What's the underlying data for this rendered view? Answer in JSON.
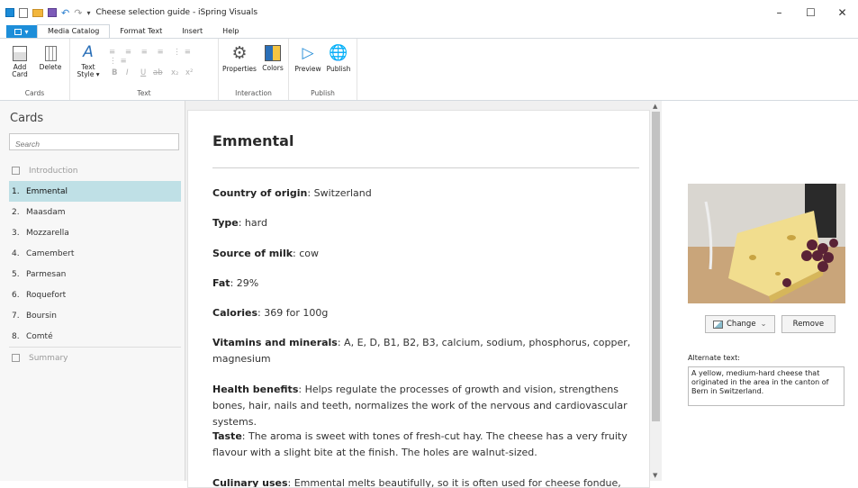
{
  "window": {
    "title": "Cheese selection guide - iSpring Visuals"
  },
  "ribbon": {
    "tabs": [
      "Media Catalog",
      "Format Text",
      "Insert",
      "Help"
    ],
    "file_label": "▾",
    "groups": {
      "cards": {
        "label": "Cards",
        "add": "Add Card",
        "delete": "Delete"
      },
      "text": {
        "label": "Text",
        "text_style": "Text Style ▾",
        "bold": "B",
        "italic": "I",
        "underline": "U",
        "strike": "ab",
        "subscript": "x₂",
        "superscript": "x²"
      },
      "interaction": {
        "label": "Interaction",
        "properties": "Properties",
        "colors": "Colors"
      },
      "publish": {
        "label": "Publish",
        "preview": "Preview",
        "publish": "Publish"
      }
    }
  },
  "sidebar": {
    "heading": "Cards",
    "search_placeholder": "Search",
    "intro": "Introduction",
    "items": [
      {
        "num": "1.",
        "label": "Emmental"
      },
      {
        "num": "2.",
        "label": "Maasdam"
      },
      {
        "num": "3.",
        "label": "Mozzarella"
      },
      {
        "num": "4.",
        "label": "Camembert"
      },
      {
        "num": "5.",
        "label": "Parmesan"
      },
      {
        "num": "6.",
        "label": "Roquefort"
      },
      {
        "num": "7.",
        "label": "Boursin"
      },
      {
        "num": "8.",
        "label": "Comté"
      }
    ],
    "summary": "Summary"
  },
  "content": {
    "title": "Emmental",
    "fields": [
      {
        "label": "Country of origin",
        "value": ": Switzerland"
      },
      {
        "label": "Type",
        "value": ": hard"
      },
      {
        "label": "Source of milk",
        "value": ": cow"
      },
      {
        "label": "Fat",
        "value": ": 29%"
      },
      {
        "label": "Calories",
        "value": ": 369 for 100g"
      },
      {
        "label": "Vitamins and minerals",
        "value": ": A, E, D, B1, B2, B3, calcium, sodium, phosphorus, copper, magnesium"
      },
      {
        "label": "Health benefits",
        "value": ": Helps regulate the processes of growth and vision, strengthens bones, hair, nails and teeth, normalizes the work of the nervous and cardiovascular systems."
      },
      {
        "label": "Taste",
        "value": ": The aroma is sweet with tones of fresh-cut hay. The cheese has a very fruity flavour with a slight bite at the finish. The holes are walnut-sized."
      },
      {
        "label": "Culinary uses",
        "value": ": Emmental melts beautifully, so it is often used for cheese fondue, soups,"
      }
    ]
  },
  "media": {
    "change": "Change",
    "remove": "Remove",
    "alt_label": "Alternate text:",
    "alt_text": "A yellow, medium-hard cheese that originated in the area in the canton of Bern in Switzerland."
  },
  "colors": {
    "accent": "#1d8ed9",
    "selected": "#bfe0e6"
  }
}
